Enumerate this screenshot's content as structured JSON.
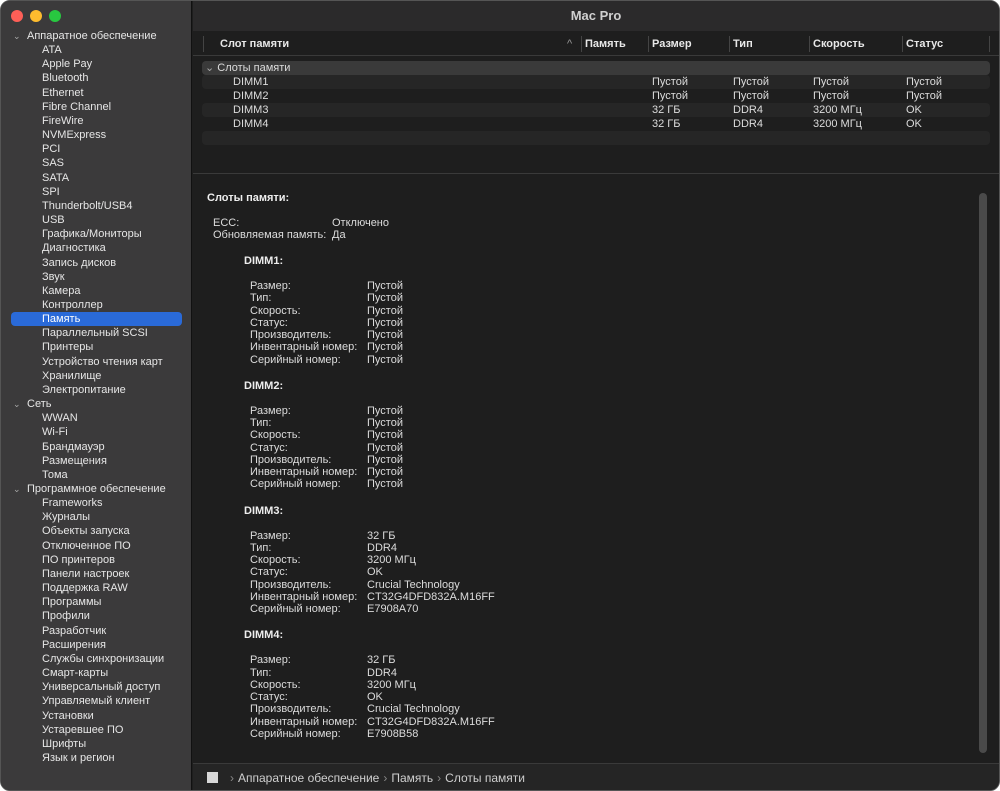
{
  "window": {
    "title": "Mac Pro"
  },
  "sidebar": {
    "selected": "Память",
    "categories": [
      {
        "label": "Аппаратное обеспечение",
        "items": [
          "ATA",
          "Apple Pay",
          "Bluetooth",
          "Ethernet",
          "Fibre Channel",
          "FireWire",
          "NVMExpress",
          "PCI",
          "SAS",
          "SATA",
          "SPI",
          "Thunderbolt/USB4",
          "USB",
          "Графика/Мониторы",
          "Диагностика",
          "Запись дисков",
          "Звук",
          "Камера",
          "Контроллер",
          "Память",
          "Параллельный SCSI",
          "Принтеры",
          "Устройство чтения карт",
          "Хранилище",
          "Электропитание"
        ]
      },
      {
        "label": "Сеть",
        "items": [
          "WWAN",
          "Wi-Fi",
          "Брандмауэр",
          "Размещения",
          "Тома"
        ]
      },
      {
        "label": "Программное обеспечение",
        "items": [
          "Frameworks",
          "Журналы",
          "Объекты запуска",
          "Отключенное ПО",
          "ПО принтеров",
          "Панели настроек",
          "Поддержка RAW",
          "Программы",
          "Профили",
          "Разработчик",
          "Расширения",
          "Службы синхронизации",
          "Смарт-карты",
          "Универсальный доступ",
          "Управляемый клиент",
          "Установки",
          "Устаревшее ПО",
          "Шрифты",
          "Язык и регион"
        ]
      }
    ]
  },
  "table": {
    "columns": [
      "Слот памяти",
      "Память",
      "Размер",
      "Тип",
      "Скорость",
      "Статус"
    ],
    "sort_indicator": "^",
    "group": "Слоты памяти",
    "rows": [
      [
        "DIMM1",
        "",
        "Пустой",
        "Пустой",
        "Пустой",
        "Пустой"
      ],
      [
        "DIMM2",
        "",
        "Пустой",
        "Пустой",
        "Пустой",
        "Пустой"
      ],
      [
        "DIMM3",
        "",
        "32 ГБ",
        "DDR4",
        "3200 МГц",
        "OK"
      ],
      [
        "DIMM4",
        "",
        "32 ГБ",
        "DDR4",
        "3200 МГц",
        "OK"
      ]
    ]
  },
  "detail": {
    "title": "Слоты памяти:",
    "summary": [
      [
        "ECC:",
        "Отключено"
      ],
      [
        "Обновляемая память:",
        "Да"
      ]
    ],
    "slots": [
      {
        "name": "DIMM1:",
        "fields": [
          [
            "Размер:",
            "Пустой"
          ],
          [
            "Тип:",
            "Пустой"
          ],
          [
            "Скорость:",
            "Пустой"
          ],
          [
            "Статус:",
            "Пустой"
          ],
          [
            "Производитель:",
            "Пустой"
          ],
          [
            "Инвентарный номер:",
            "Пустой"
          ],
          [
            "Серийный номер:",
            "Пустой"
          ]
        ]
      },
      {
        "name": "DIMM2:",
        "fields": [
          [
            "Размер:",
            "Пустой"
          ],
          [
            "Тип:",
            "Пустой"
          ],
          [
            "Скорость:",
            "Пустой"
          ],
          [
            "Статус:",
            "Пустой"
          ],
          [
            "Производитель:",
            "Пустой"
          ],
          [
            "Инвентарный номер:",
            "Пустой"
          ],
          [
            "Серийный номер:",
            "Пустой"
          ]
        ]
      },
      {
        "name": "DIMM3:",
        "fields": [
          [
            "Размер:",
            "32 ГБ"
          ],
          [
            "Тип:",
            "DDR4"
          ],
          [
            "Скорость:",
            "3200 МГц"
          ],
          [
            "Статус:",
            "OK"
          ],
          [
            "Производитель:",
            "Crucial Technology"
          ],
          [
            "Инвентарный номер:",
            "CT32G4DFD832A.M16FF"
          ],
          [
            "Серийный номер:",
            "E7908A70"
          ]
        ]
      },
      {
        "name": "DIMM4:",
        "fields": [
          [
            "Размер:",
            "32 ГБ"
          ],
          [
            "Тип:",
            "DDR4"
          ],
          [
            "Скорость:",
            "3200 МГц"
          ],
          [
            "Статус:",
            "OK"
          ],
          [
            "Производитель:",
            "Crucial Technology"
          ],
          [
            "Инвентарный номер:",
            "CT32G4DFD832A.M16FF"
          ],
          [
            "Серийный номер:",
            "E7908B58"
          ]
        ]
      }
    ]
  },
  "pathbar": {
    "items": [
      "Аппаратное обеспечение",
      "Память",
      "Слоты памяти"
    ],
    "separator": "›"
  },
  "colors": {
    "accent": "#2a6ad8",
    "close": "#fe5f57",
    "minimize": "#febc2e",
    "zoom": "#28c840"
  }
}
